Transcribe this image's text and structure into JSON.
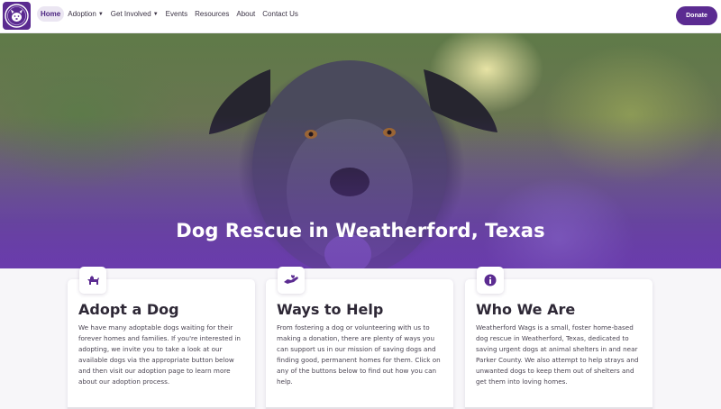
{
  "nav": {
    "items": [
      {
        "label": "Home",
        "active": true,
        "dropdown": false
      },
      {
        "label": "Adoption",
        "active": false,
        "dropdown": true
      },
      {
        "label": "Get Involved",
        "active": false,
        "dropdown": true
      },
      {
        "label": "Events",
        "active": false,
        "dropdown": false
      },
      {
        "label": "Resources",
        "active": false,
        "dropdown": false
      },
      {
        "label": "About",
        "active": false,
        "dropdown": false
      },
      {
        "label": "Contact Us",
        "active": false,
        "dropdown": false
      }
    ],
    "donate_label": "Donate",
    "logo_icon": "dog-paw-logo-icon"
  },
  "hero": {
    "title": "Dog Rescue in Weatherford, Texas"
  },
  "cards": [
    {
      "icon": "dog-icon",
      "title": "Adopt a Dog",
      "text": "We have many adoptable dogs waiting for their forever homes and families. If you're interested in adopting, we invite you to take a look at our available dogs via the appropriate button below and then visit our adoption page to learn more about our adoption process."
    },
    {
      "icon": "helping-hand-icon",
      "title": "Ways to Help",
      "text": "From fostering a dog or volunteering with us to making a donation, there are plenty of ways you can support us in our mission of saving dogs and finding good, permanent homes for them. Click on any of the buttons below to find out how you can help."
    },
    {
      "icon": "info-icon",
      "title": "Who We Are",
      "text": "Weatherford Wags is a small, foster home-based dog rescue in Weatherford, Texas, dedicated to saving urgent dogs at animal shelters in and near Parker County. We also attempt to help strays and unwanted dogs to keep them out of shelters and get them into loving homes."
    }
  ],
  "colors": {
    "brand": "#5b2b91",
    "active_nav_bg": "#ebe6f2"
  }
}
